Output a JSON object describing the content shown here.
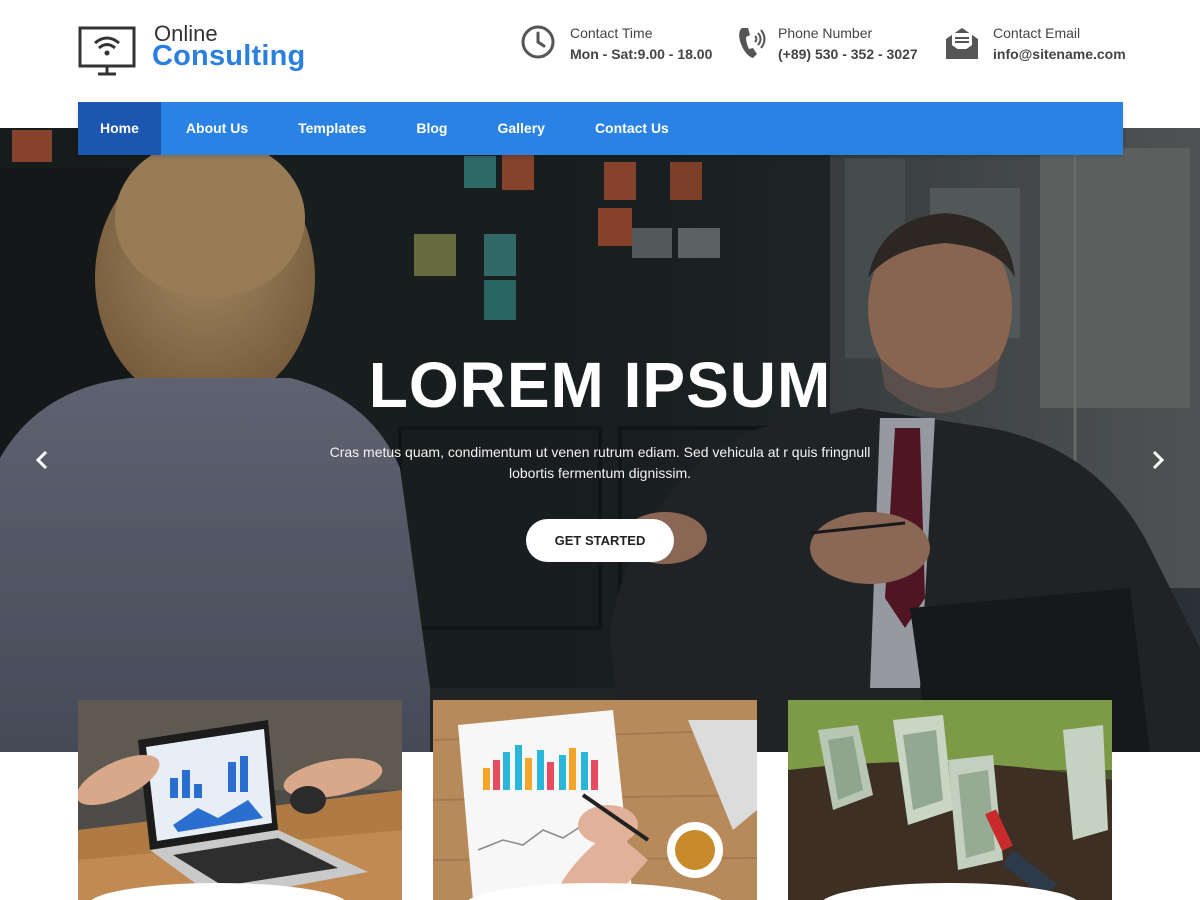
{
  "logo": {
    "line1": "Online",
    "line2": "Consulting",
    "icon": "monitor-wifi-icon"
  },
  "contacts": [
    {
      "icon": "clock-icon",
      "label": "Contact Time",
      "value": "Mon - Sat:9.00 - 18.00"
    },
    {
      "icon": "phone-icon",
      "label": "Phone Number",
      "value": "(+89) 530 - 352 - 3027"
    },
    {
      "icon": "envelope-icon",
      "label": "Contact Email",
      "value": "info@sitename.com"
    }
  ],
  "nav": {
    "items": [
      {
        "label": "Home",
        "active": true
      },
      {
        "label": "About Us"
      },
      {
        "label": "Templates"
      },
      {
        "label": "Blog"
      },
      {
        "label": "Gallery"
      },
      {
        "label": "Contact Us"
      }
    ]
  },
  "hero": {
    "title": "LOREM IPSUM",
    "text": "Cras metus quam, condimentum ut venen rutrum ediam. Sed vehicula at r quis fringnull lobortis fermentum dignissim.",
    "button": "GET STARTED",
    "prev_icon": "chevron-left-icon",
    "next_icon": "chevron-right-icon"
  },
  "cards": [
    {
      "image": "laptop-analytics-photo"
    },
    {
      "image": "bar-chart-report-photo"
    },
    {
      "image": "money-plant-photo"
    }
  ],
  "colors": {
    "brand_blue": "#2a82e4",
    "nav_active": "#1b56b0",
    "logo_blue": "#2a7fe0"
  }
}
